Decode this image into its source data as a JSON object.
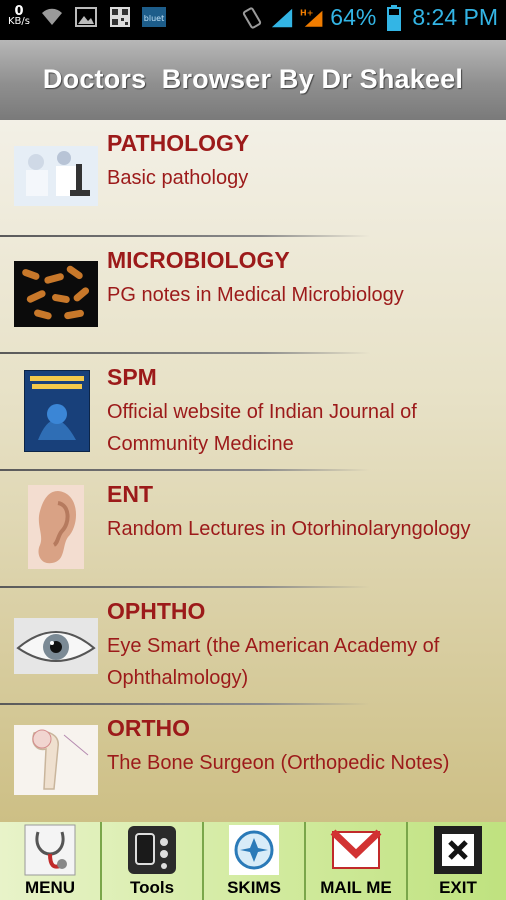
{
  "status_bar": {
    "data_speed_value": "0",
    "data_speed_unit": "KB/s",
    "icons": [
      "wifi-icon",
      "image-icon",
      "qr-icon",
      "bluetooth-app-icon",
      "vibrate-icon",
      "signal-icon",
      "signal-hplus-icon",
      "battery-icon"
    ],
    "battery_percent": "64%",
    "time": "8:24 PM"
  },
  "header": {
    "title": "Doctors  Browser By Dr Shakeel"
  },
  "list": {
    "items": [
      {
        "title": "PATHOLOGY",
        "subtitle": "Basic pathology",
        "icon": "microscope-lab-image"
      },
      {
        "title": "MICROBIOLOGY",
        "subtitle": "PG notes in Medical Microbiology",
        "icon": "bacteria-image"
      },
      {
        "title": "SPM",
        "subtitle": "Official website of Indian Journal of Community Medicine",
        "icon": "community-medicine-book-image"
      },
      {
        "title": "ENT",
        "subtitle": "Random Lectures in Otorhinolaryngology",
        "icon": "ear-image"
      },
      {
        "title": "OPHTHO",
        "subtitle": "Eye Smart (the  American Academy of Ophthalmology)",
        "icon": "eye-image"
      },
      {
        "title": "ORTHO",
        "subtitle": "The Bone Surgeon (Orthopedic Notes)",
        "icon": "bone-xray-image"
      }
    ]
  },
  "bottom_bar": {
    "buttons": [
      {
        "label": "MENU",
        "icon": "stethoscope-icon"
      },
      {
        "label": "Tools",
        "icon": "phone-tools-icon"
      },
      {
        "label": "SKIMS",
        "icon": "skims-logo-icon"
      },
      {
        "label": "MAIL ME",
        "icon": "gmail-icon"
      },
      {
        "label": "EXIT",
        "icon": "exit-x-icon"
      }
    ]
  },
  "colors": {
    "accent_text": "#9c1a1a",
    "status_blue": "#33b5e5",
    "bottom_bar_green": "#d3eba1"
  }
}
